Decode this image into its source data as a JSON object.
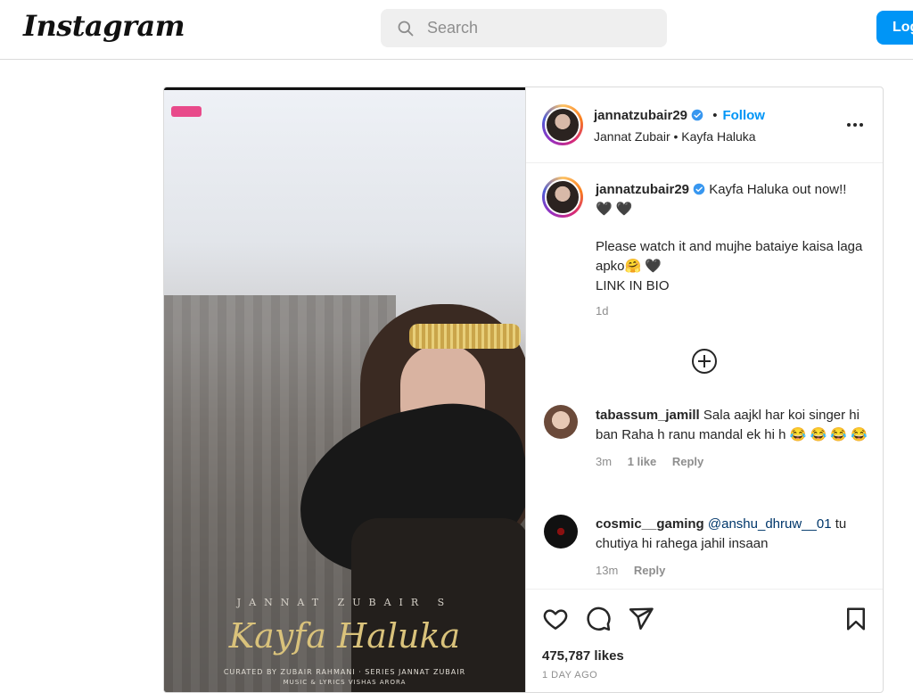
{
  "header": {
    "logo": "Instagram",
    "search_placeholder": "Search",
    "login_label": "Log in"
  },
  "post": {
    "media": {
      "overlay_subtitle": "JANNAT ZUBAIR S",
      "overlay_title": "Kayfa Haluka",
      "overlay_credits": "CURATED BY ZUBAIR RAHMANI · SERIES JANNAT ZUBAIR",
      "overlay_credits2": "MUSIC & LYRICS VISHAS ARORA"
    },
    "author": {
      "username": "jannatzubair29",
      "follow_label": "Follow",
      "subtitle": "Jannat Zubair • Kayfa Haluka"
    },
    "caption": {
      "username": "jannatzubair29",
      "line1": "Kayfa Haluka out now!!🖤 🖤",
      "line2": "Please watch it and mujhe bataiye kaisa laga apko🤗 🖤",
      "line3": "LINK IN BIO",
      "time": "1d"
    },
    "comments": [
      {
        "username": "tabassum_jamill",
        "text": "Sala aajkl har koi singer hi ban Raha h ranu mandal ek hi h 😂 😂 😂 😂",
        "time": "3m",
        "likes": "1 like",
        "reply": "Reply"
      },
      {
        "username": "cosmic__gaming",
        "mention": "@anshu_dhruw__01",
        "text": "tu chutiya hi rahega jahil insaan",
        "time": "13m",
        "reply": "Reply"
      }
    ],
    "likes": "475,787 likes",
    "posted": "1 DAY AGO"
  }
}
